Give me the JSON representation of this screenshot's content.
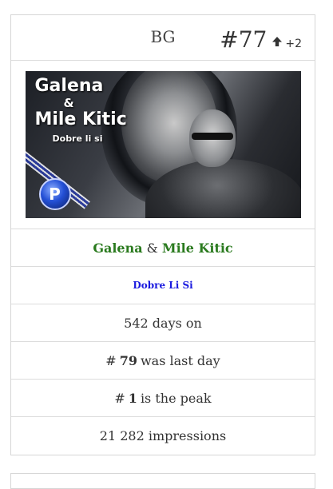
{
  "header": {
    "country": "BG",
    "rank": "#77",
    "trend_icon": "arrow-up-icon",
    "delta": "+2"
  },
  "cover": {
    "line1": "Galena",
    "line2": "&",
    "line3": "Mile Kitic",
    "line4": "Dobre li si",
    "badge": "P"
  },
  "artists": {
    "artist1": "Galena",
    "separator": "&",
    "artist2": "Mile Kitic",
    "artist_color": "#2a7a1e"
  },
  "song": {
    "title": "Dobre Li Si",
    "color": "#1a1adf"
  },
  "stats": {
    "days_on": "542 days on",
    "last_day_prefix": "#",
    "last_day_value": "79",
    "last_day_suffix": "was last day",
    "peak_prefix": "#",
    "peak_value": "1",
    "peak_suffix": "is the peak",
    "impressions": "21 282 impressions"
  }
}
